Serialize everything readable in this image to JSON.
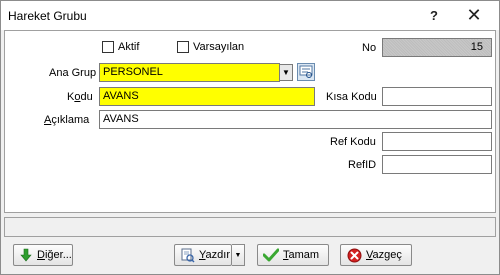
{
  "window": {
    "title": "Hareket Grubu",
    "help_label": "?",
    "close_label": "✕"
  },
  "form": {
    "aktif_label": "Aktif",
    "varsayilan_label": "Varsayılan",
    "no_label": "No",
    "no_value": "15",
    "ana_grup_label": "Ana Grup",
    "ana_grup_value": "PERSONEL",
    "kodu_label_prefix": "K",
    "kodu_label_accel": "o",
    "kodu_label_suffix": "du",
    "kodu_value": "AVANS",
    "kisa_kodu_label": "Kısa Kodu",
    "kisa_kodu_value": "",
    "aciklama_label_accel": "A",
    "aciklama_label_suffix": "çıklama",
    "aciklama_value": "AVANS",
    "ref_kodu_label": "Ref Kodu",
    "ref_kodu_value": "",
    "refid_label": "RefID",
    "refid_value": ""
  },
  "footer": {
    "diger_accel": "D",
    "diger_suffix": "iğer...",
    "yazdir_accel": "Y",
    "yazdir_suffix": "azdır",
    "tamam_accel": "T",
    "tamam_suffix": "amam",
    "vazgec_accel": "V",
    "vazgec_suffix": "azgeç"
  },
  "colors": {
    "highlight_field": "#ffff00",
    "ok_icon": "#3aa832",
    "cancel_icon": "#d42020",
    "down_arrow_icon": "#2e9e2e"
  },
  "icons": [
    "help-icon",
    "close-icon",
    "chevron-down-icon",
    "lookup-icon",
    "arrow-down-icon",
    "printer-icon",
    "checkmark-icon",
    "cancel-icon"
  ]
}
